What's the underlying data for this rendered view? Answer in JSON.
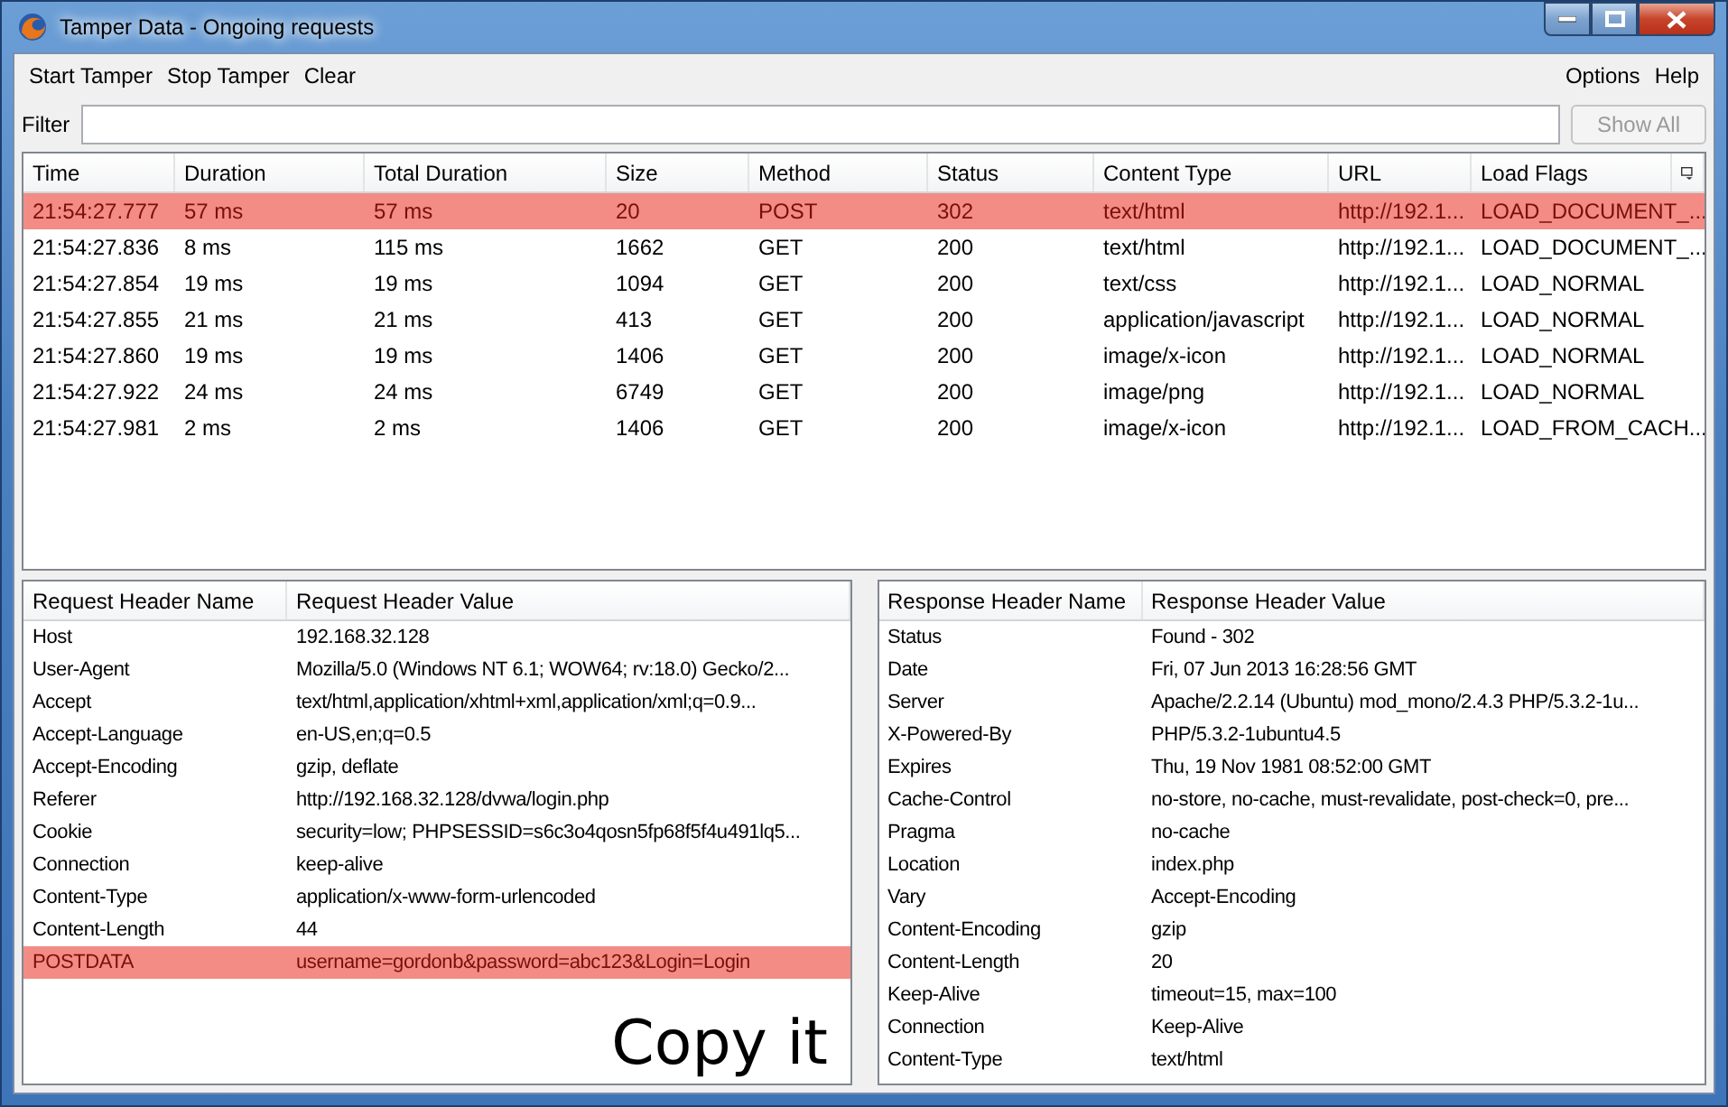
{
  "window": {
    "title": "Tamper Data - Ongoing requests"
  },
  "menu": {
    "left": [
      "Start Tamper",
      "Stop Tamper",
      "Clear"
    ],
    "right": [
      "Options",
      "Help"
    ]
  },
  "filter": {
    "label": "Filter",
    "button": "Show All",
    "button_disabled": true
  },
  "requests": {
    "columns": [
      "Time",
      "Duration",
      "Total Duration",
      "Size",
      "Method",
      "Status",
      "Content Type",
      "URL",
      "Load Flags"
    ],
    "rows": [
      {
        "highlighted": true,
        "cells": [
          "21:54:27.777",
          "57 ms",
          "57 ms",
          "20",
          "POST",
          "302",
          "text/html",
          "http://192.1...",
          "LOAD_DOCUMENT_..."
        ]
      },
      {
        "highlighted": false,
        "cells": [
          "21:54:27.836",
          "8 ms",
          "115 ms",
          "1662",
          "GET",
          "200",
          "text/html",
          "http://192.1...",
          "LOAD_DOCUMENT_..."
        ]
      },
      {
        "highlighted": false,
        "cells": [
          "21:54:27.854",
          "19 ms",
          "19 ms",
          "1094",
          "GET",
          "200",
          "text/css",
          "http://192.1...",
          "LOAD_NORMAL"
        ]
      },
      {
        "highlighted": false,
        "cells": [
          "21:54:27.855",
          "21 ms",
          "21 ms",
          "413",
          "GET",
          "200",
          "application/javascript",
          "http://192.1...",
          "LOAD_NORMAL"
        ]
      },
      {
        "highlighted": false,
        "cells": [
          "21:54:27.860",
          "19 ms",
          "19 ms",
          "1406",
          "GET",
          "200",
          "image/x-icon",
          "http://192.1...",
          "LOAD_NORMAL"
        ]
      },
      {
        "highlighted": false,
        "cells": [
          "21:54:27.922",
          "24 ms",
          "24 ms",
          "6749",
          "GET",
          "200",
          "image/png",
          "http://192.1...",
          "LOAD_NORMAL"
        ]
      },
      {
        "highlighted": false,
        "cells": [
          "21:54:27.981",
          "2 ms",
          "2 ms",
          "1406",
          "GET",
          "200",
          "image/x-icon",
          "http://192.1...",
          "LOAD_FROM_CACH..."
        ]
      }
    ]
  },
  "request_headers": {
    "columns": [
      "Request Header Name",
      "Request Header Value"
    ],
    "rows": [
      {
        "highlighted": false,
        "cells": [
          "Host",
          "192.168.32.128"
        ]
      },
      {
        "highlighted": false,
        "cells": [
          "User-Agent",
          "Mozilla/5.0 (Windows NT 6.1; WOW64; rv:18.0) Gecko/2..."
        ]
      },
      {
        "highlighted": false,
        "cells": [
          "Accept",
          "text/html,application/xhtml+xml,application/xml;q=0.9..."
        ]
      },
      {
        "highlighted": false,
        "cells": [
          "Accept-Language",
          "en-US,en;q=0.5"
        ]
      },
      {
        "highlighted": false,
        "cells": [
          "Accept-Encoding",
          "gzip, deflate"
        ]
      },
      {
        "highlighted": false,
        "cells": [
          "Referer",
          "http://192.168.32.128/dvwa/login.php"
        ]
      },
      {
        "highlighted": false,
        "cells": [
          "Cookie",
          "security=low; PHPSESSID=s6c3o4qosn5fp68f5f4u491lq5..."
        ]
      },
      {
        "highlighted": false,
        "cells": [
          "Connection",
          "keep-alive"
        ]
      },
      {
        "highlighted": false,
        "cells": [
          "Content-Type",
          "application/x-www-form-urlencoded"
        ]
      },
      {
        "highlighted": false,
        "cells": [
          "Content-Length",
          "44"
        ]
      },
      {
        "highlighted": true,
        "cells": [
          "POSTDATA",
          "username=gordonb&password=abc123&Login=Login"
        ]
      }
    ],
    "annotation": "Copy it"
  },
  "response_headers": {
    "columns": [
      "Response Header Name",
      "Response Header Value"
    ],
    "rows": [
      {
        "highlighted": false,
        "cells": [
          "Status",
          "Found - 302"
        ]
      },
      {
        "highlighted": false,
        "cells": [
          "Date",
          "Fri, 07 Jun 2013 16:28:56 GMT"
        ]
      },
      {
        "highlighted": false,
        "cells": [
          "Server",
          "Apache/2.2.14 (Ubuntu) mod_mono/2.4.3 PHP/5.3.2-1u..."
        ]
      },
      {
        "highlighted": false,
        "cells": [
          "X-Powered-By",
          "PHP/5.3.2-1ubuntu4.5"
        ]
      },
      {
        "highlighted": false,
        "cells": [
          "Expires",
          "Thu, 19 Nov 1981 08:52:00 GMT"
        ]
      },
      {
        "highlighted": false,
        "cells": [
          "Cache-Control",
          "no-store, no-cache, must-revalidate, post-check=0, pre..."
        ]
      },
      {
        "highlighted": false,
        "cells": [
          "Pragma",
          "no-cache"
        ]
      },
      {
        "highlighted": false,
        "cells": [
          "Location",
          "index.php"
        ]
      },
      {
        "highlighted": false,
        "cells": [
          "Vary",
          "Accept-Encoding"
        ]
      },
      {
        "highlighted": false,
        "cells": [
          "Content-Encoding",
          "gzip"
        ]
      },
      {
        "highlighted": false,
        "cells": [
          "Content-Length",
          "20"
        ]
      },
      {
        "highlighted": false,
        "cells": [
          "Keep-Alive",
          "timeout=15, max=100"
        ]
      },
      {
        "highlighted": false,
        "cells": [
          "Connection",
          "Keep-Alive"
        ]
      },
      {
        "highlighted": false,
        "cells": [
          "Content-Type",
          "text/html"
        ]
      }
    ]
  }
}
